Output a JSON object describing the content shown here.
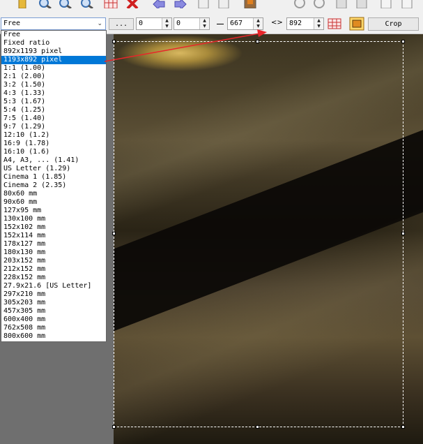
{
  "toolbar": {
    "icons": [
      {
        "name": "folder-icon",
        "color": "#e0b030"
      },
      {
        "name": "zoom-in-icon",
        "color": "#3a6fb0"
      },
      {
        "name": "zoom-1-1-icon",
        "color": "#3a6fb0"
      },
      {
        "name": "zoom-out-icon",
        "color": "#3a6fb0"
      },
      {
        "name": "table-grid-icon",
        "color": "#c83030"
      },
      {
        "name": "close-x-icon",
        "color": "#d02020"
      },
      {
        "name": "arrow-left-icon",
        "color": "#7a7ad8"
      },
      {
        "name": "arrow-right-icon",
        "color": "#7a7ad8"
      },
      {
        "name": "copy-icon",
        "color": "#888888"
      },
      {
        "name": "paste-icon",
        "color": "#888888"
      },
      {
        "name": "color-picker-icon",
        "color": "#e08020"
      },
      {
        "name": "rotate-left-icon",
        "color": "#9a9a9a"
      },
      {
        "name": "rotate-right-icon",
        "color": "#9a9a9a"
      },
      {
        "name": "save-icon",
        "color": "#888888"
      },
      {
        "name": "save-as-icon",
        "color": "#888888"
      },
      {
        "name": "info-icon",
        "color": "#888888"
      },
      {
        "name": "options-icon",
        "color": "#888888"
      }
    ],
    "ratio_selected": "Free",
    "more_button": "...",
    "x_value": "0",
    "y_value": "0",
    "width_value": "667",
    "swap_symbol": "<>",
    "height_value": "892",
    "crop_button": "Crop"
  },
  "ratio_options": [
    "Free",
    "Fixed ratio",
    "892x1193 pixel",
    "1193x892 pixel",
    "1:1 (1.00)",
    "2:1 (2.00)",
    "3:2 (1.50)",
    "4:3 (1.33)",
    "5:3 (1.67)",
    "5:4 (1.25)",
    "7:5 (1.40)",
    "9:7 (1.29)",
    "12:10 (1.2)",
    "16:9 (1.78)",
    "16:10 (1.6)",
    "A4, A3, ... (1.41)",
    "US Letter (1.29)",
    "Cinema 1 (1.85)",
    "Cinema 2 (2.35)",
    "80x60 mm",
    "90x60 mm",
    "127x95 mm",
    "130x100 mm",
    "152x102 mm",
    "152x114 mm",
    "178x127 mm",
    "180x130 mm",
    "203x152 mm",
    "212x152 mm",
    "228x152 mm",
    "27.9x21.6 [US Letter]",
    "297x210 mm",
    "305x203 mm",
    "457x305 mm",
    "600x400 mm",
    "762x508 mm",
    "800x600 mm"
  ],
  "selected_option": "1193x892 pixel",
  "annotation": {
    "color": "#e8262a"
  }
}
